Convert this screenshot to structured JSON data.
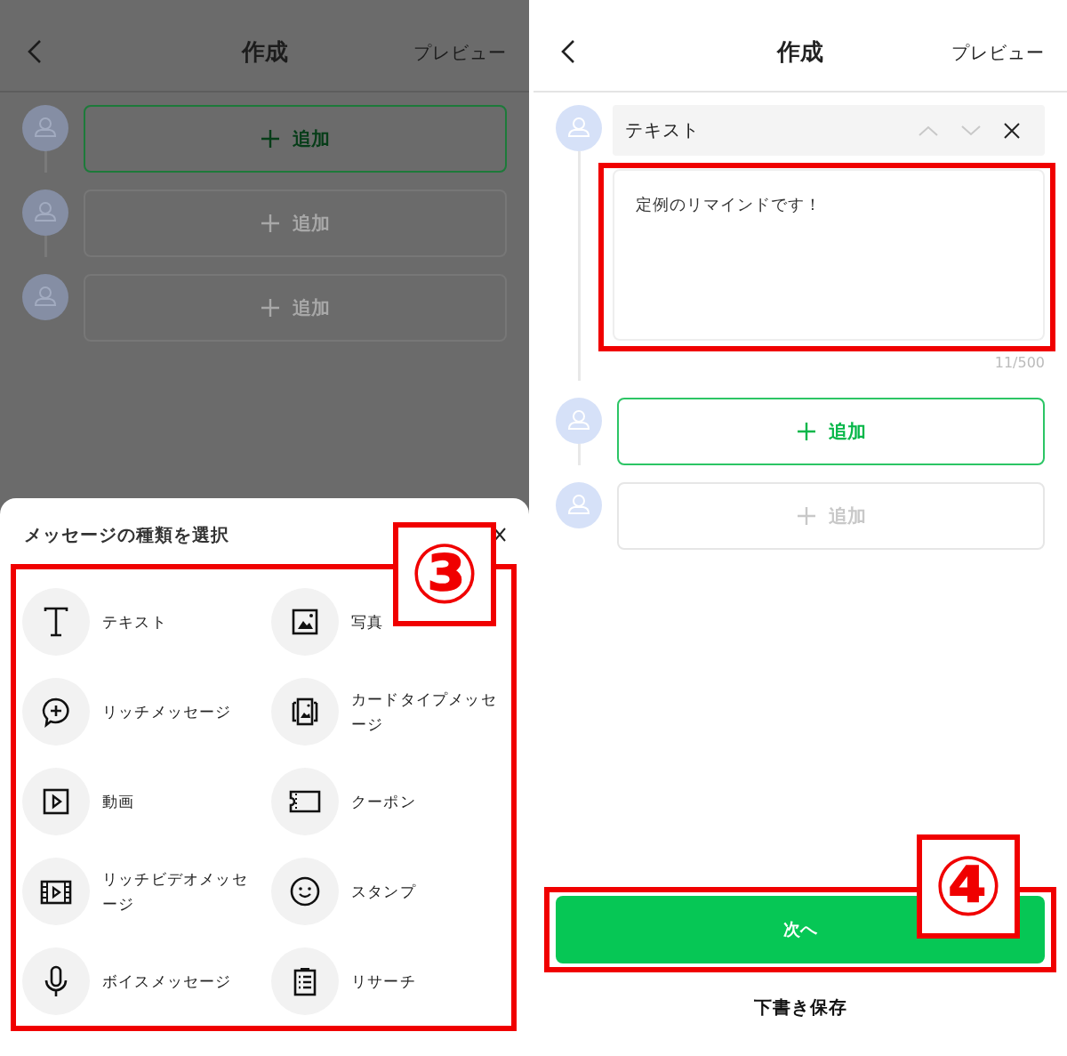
{
  "left_screen": {
    "dimmed": true,
    "header": {
      "title": "作成",
      "action": "プレビュー"
    },
    "messages": [
      {
        "kind": "add",
        "label": "追加",
        "active": true
      },
      {
        "kind": "add",
        "label": "追加",
        "active": false
      },
      {
        "kind": "add",
        "label": "追加",
        "active": false
      }
    ],
    "type_sheet": {
      "title": "メッセージの種類を選択",
      "callout": "③",
      "types": [
        {
          "kind": "text",
          "label": "テキスト"
        },
        {
          "kind": "rich_message",
          "label": "リッチメッセージ"
        },
        {
          "kind": "video",
          "label": "動画"
        },
        {
          "kind": "rich_video",
          "label": "リッチビデオメッセージ"
        },
        {
          "kind": "voice",
          "label": "ボイスメッセージ"
        },
        {
          "kind": "photo",
          "label": "写真"
        },
        {
          "kind": "card",
          "label": "カードタイプメッセージ"
        },
        {
          "kind": "coupon",
          "label": "クーポン"
        },
        {
          "kind": "sticker",
          "label": "スタンプ"
        },
        {
          "kind": "research",
          "label": "リサーチ"
        }
      ]
    }
  },
  "right_screen": {
    "dimmed": false,
    "header": {
      "title": "作成",
      "action": "プレビュー"
    },
    "messages": [
      {
        "kind": "text",
        "type_label": "テキスト",
        "value": "定例のリマインドです！",
        "counter": "11/500",
        "callout_frame": true
      },
      {
        "kind": "add",
        "label": "追加",
        "active": true
      },
      {
        "kind": "add",
        "label": "追加",
        "active": false
      }
    ],
    "footer": {
      "next_button": "次へ",
      "callout": "④",
      "draft_button": "下書き保存"
    }
  }
}
